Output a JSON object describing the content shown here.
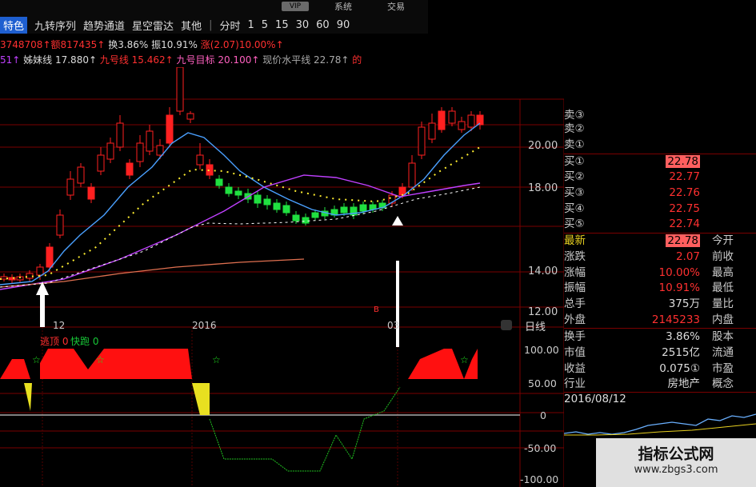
{
  "toolbar": {
    "active_tab": "特色",
    "tabs": [
      "九转序列",
      "趋势通道",
      "星空雷达",
      "其他"
    ],
    "sep": "|",
    "time_label": "分时",
    "periods": [
      "1",
      "5",
      "15",
      "30",
      "60",
      "90"
    ],
    "vip": "VIP",
    "system": "系统",
    "trade": "交易"
  },
  "info1": {
    "a": "3748708↑",
    "b": "额817435↑",
    "c": "换3.86%",
    "d": "振10.91%",
    "e": "涨(2.07)10.00%↑"
  },
  "info2": {
    "a": "51↑",
    "b": "姊妹线 17.880↑",
    "c": "九号线 15.462↑",
    "d": "九号目标 20.100↑",
    "e": "现价水平线 22.78↑",
    "f": "的"
  },
  "axis": {
    "prices": [
      "20.00",
      "18.00",
      "14.00",
      "12.00"
    ],
    "dates": [
      "12",
      "2016",
      "03"
    ],
    "period_label": "日线",
    "ind_ticks": [
      "100.00",
      "50.00",
      "0",
      "-50.00",
      "-100.00"
    ],
    "marker_b": "B"
  },
  "indicator": {
    "label1": "逃顶 0",
    "label2": "快跑 0"
  },
  "quote": {
    "sells": [
      "卖③",
      "卖②",
      "卖①"
    ],
    "buys": [
      {
        "label": "买①",
        "price": "22.78"
      },
      {
        "label": "买②",
        "price": "22.77"
      },
      {
        "label": "买③",
        "price": "22.76"
      },
      {
        "label": "买④",
        "price": "22.75"
      },
      {
        "label": "买⑤",
        "price": "22.74"
      }
    ],
    "stats": [
      {
        "l": "最新",
        "v": "22.78",
        "r": "今开"
      },
      {
        "l": "涨跌",
        "v": "2.07",
        "r": "前收"
      },
      {
        "l": "涨幅",
        "v": "10.00%",
        "r": "最高"
      },
      {
        "l": "振幅",
        "v": "10.91%",
        "r": "最低"
      },
      {
        "l": "总手",
        "v": "375万",
        "r": "量比"
      },
      {
        "l": "外盘",
        "v": "2145233",
        "r": "内盘"
      },
      {
        "l": "换手",
        "v": "3.86%",
        "r": "股本"
      },
      {
        "l": "市值",
        "v": "2515亿",
        "r": "流通"
      },
      {
        "l": "收益",
        "v": "0.075①",
        "r": "市盈"
      },
      {
        "l": "行业",
        "v": "房地产",
        "r": "概念"
      }
    ],
    "date": "2016/08/12"
  },
  "watermark": {
    "title": "指标公式网",
    "url": "www.zbgs3.com"
  },
  "colors": {
    "up": "#ff3030",
    "down": "#18e838",
    "ma1": "#4aa0ff",
    "ma2": "#c040ff",
    "ma3": "#e07050",
    "grid": "#7a0000"
  }
}
